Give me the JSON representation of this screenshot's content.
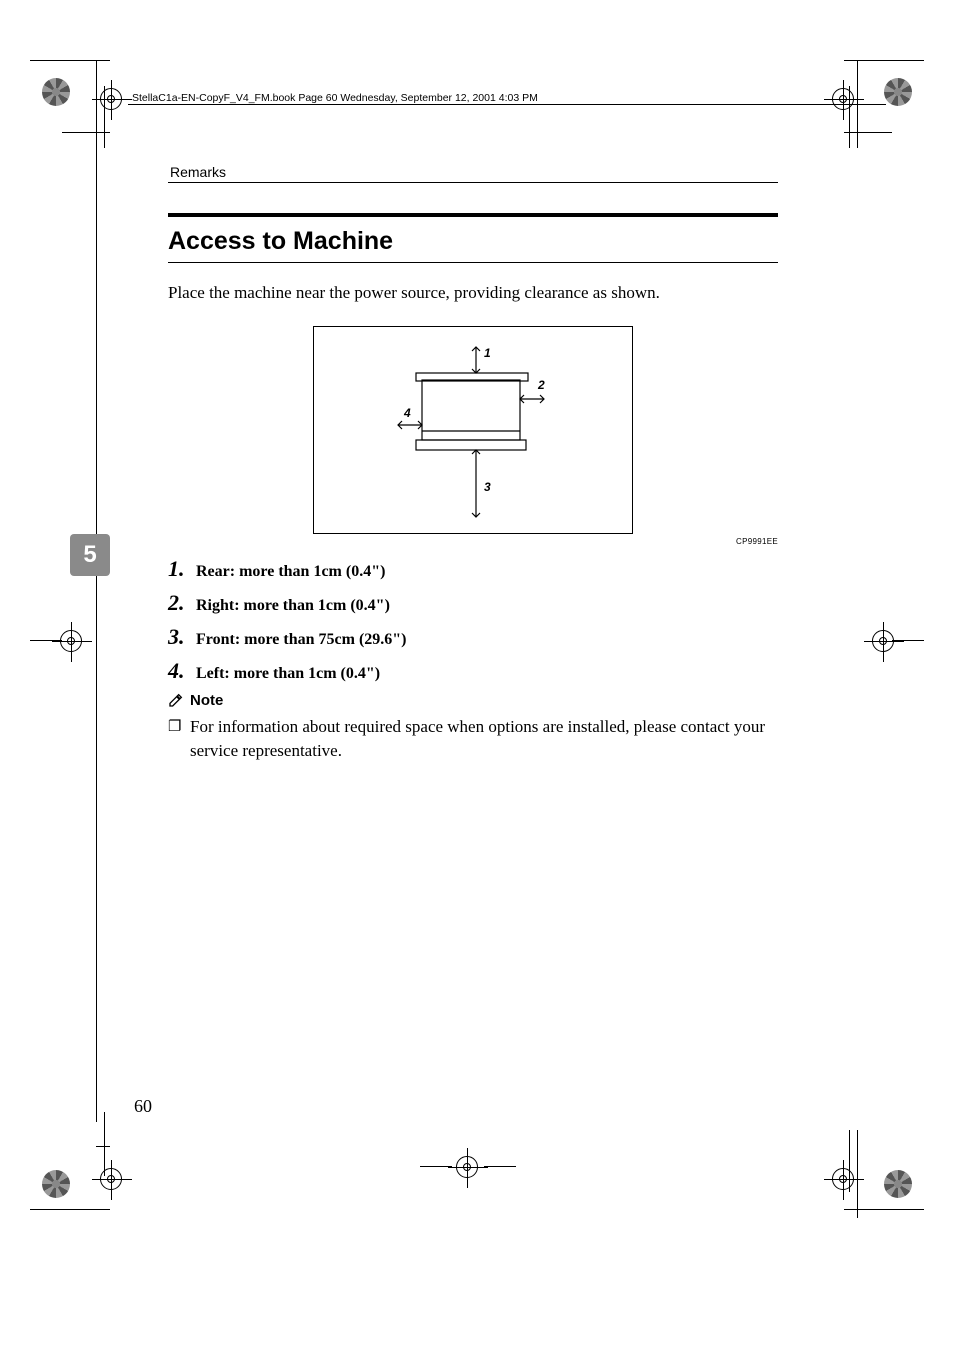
{
  "book_header": "StellaC1a-EN-CopyF_V4_FM.book  Page 60  Wednesday, September 12, 2001  4:03 PM",
  "running_head": "Remarks",
  "title": "Access to Machine",
  "lead": "Place the machine near the power source, providing clearance as shown.",
  "diagram": {
    "labels": {
      "top": "1",
      "right": "2",
      "bottom": "3",
      "left": "4"
    },
    "caption": "CP9991EE"
  },
  "list": [
    {
      "n": "1",
      "t": "Rear: more than 1cm (0.4\")"
    },
    {
      "n": "2",
      "t": "Right: more than 1cm (0.4\")"
    },
    {
      "n": "3",
      "t": "Front: more than 75cm (29.6\")"
    },
    {
      "n": "4",
      "t": "Left: more than 1cm (0.4\")"
    }
  ],
  "note": {
    "heading": "Note",
    "bullet_glyph": "❐",
    "text": "For information about required space when options are installed, please contact your service representative."
  },
  "chapter_tab": "5",
  "page_number": "60"
}
